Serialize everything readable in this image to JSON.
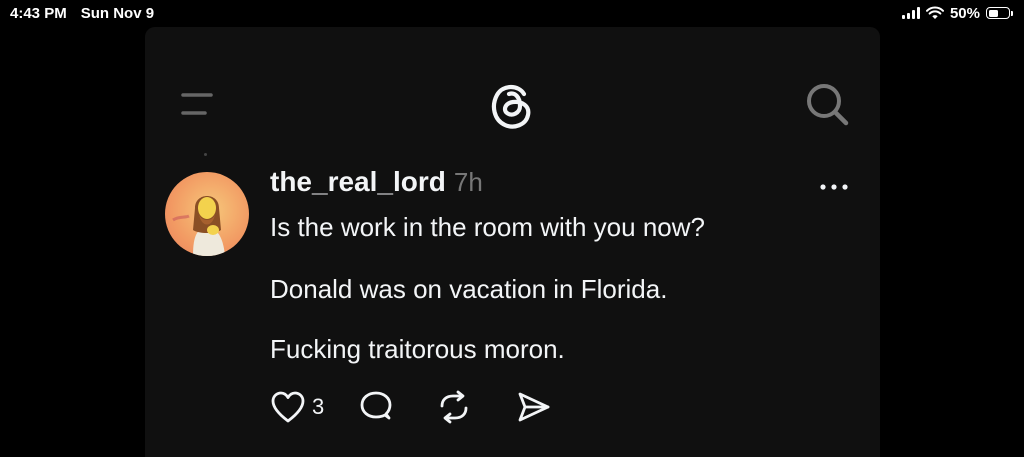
{
  "status_bar": {
    "time": "4:43 PM",
    "date": "Sun Nov 9",
    "battery_percent": "50%",
    "battery_level": 0.5
  },
  "post": {
    "username": "the_real_lord",
    "time_ago": "7h",
    "lines": [
      "Is the work in the room with you now?",
      "Donald was on vacation in Florida.",
      "Fucking traitorous moron."
    ],
    "like_count": "3"
  },
  "icons": {
    "menu": "menu-icon",
    "logo": "threads-logo-icon",
    "search": "search-icon",
    "more": "more-icon",
    "like": "heart-icon",
    "reply": "comment-icon",
    "repost": "repost-icon",
    "share": "send-icon"
  },
  "colors": {
    "background": "#000000",
    "panel": "#101010",
    "text": "#f3f5f7",
    "muted": "#777777"
  }
}
